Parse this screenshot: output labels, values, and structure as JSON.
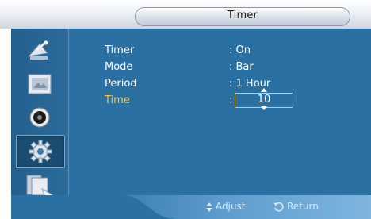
{
  "window": {
    "title": "Timer"
  },
  "sidebar": {
    "items": [
      {
        "icon": "satellite-dish-icon",
        "active": false
      },
      {
        "icon": "picture-frame-icon",
        "active": false
      },
      {
        "icon": "speaker-icon",
        "active": false
      },
      {
        "icon": "gear-icon",
        "active": true
      },
      {
        "icon": "multi-screen-icon",
        "active": false
      }
    ]
  },
  "settings": [
    {
      "label": "Timer",
      "value": ": On"
    },
    {
      "label": "Mode",
      "value": ": Bar"
    },
    {
      "label": "Period",
      "value": ": 1 Hour"
    },
    {
      "label": "Time",
      "value": ":",
      "spinner_value": "10"
    }
  ],
  "help": {
    "adjust_label": "Adjust",
    "return_label": "Return"
  },
  "colors": {
    "panel": "#2b70a2",
    "selected_text": "#f4c842",
    "text": "#ffffff"
  }
}
